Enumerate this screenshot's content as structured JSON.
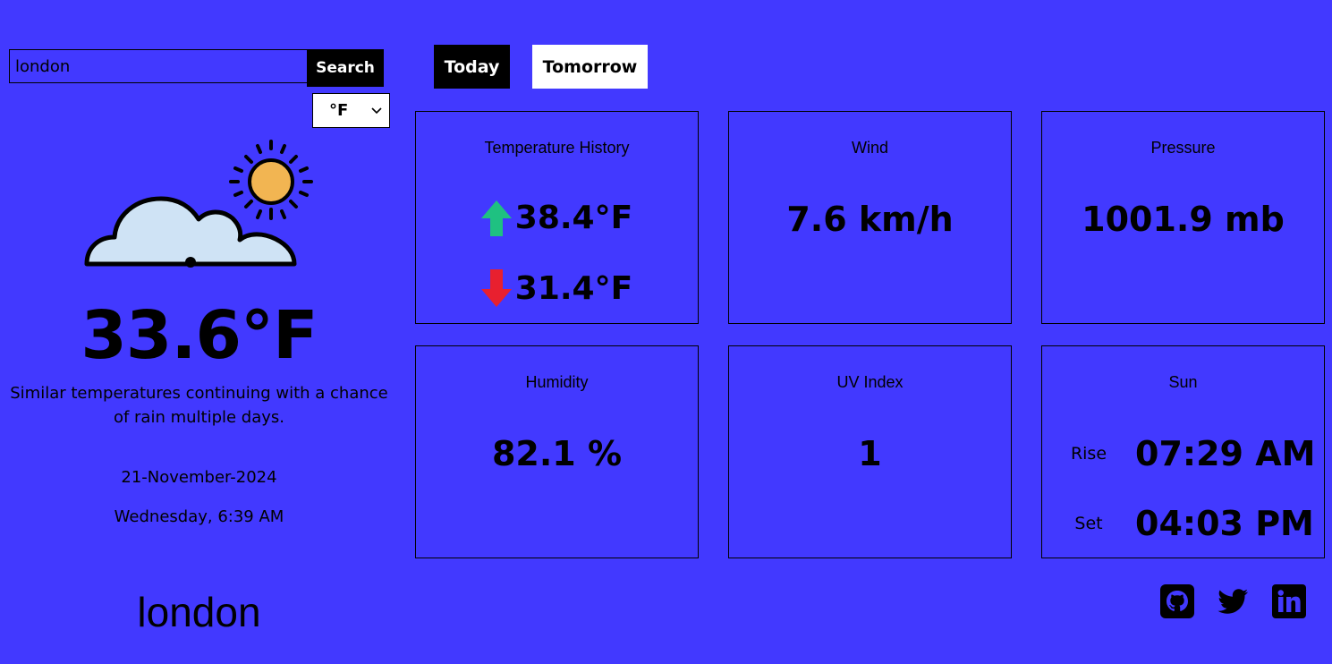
{
  "search": {
    "value": "london",
    "button_label": "Search"
  },
  "units": {
    "selected": "°F",
    "chevron_icon": "chevron-down-icon"
  },
  "current": {
    "icon": "cloud-sun-icon",
    "temperature": "33.6°F",
    "description": "Similar temperatures continuing with a chance of rain multiple days.",
    "date": "21-November-2024",
    "day_time": "Wednesday, 6:39 AM",
    "city": "london"
  },
  "tabs": [
    {
      "label": "Today",
      "active": true
    },
    {
      "label": "Tomorrow",
      "active": false
    }
  ],
  "cards": {
    "temperature_history": {
      "title": "Temperature History",
      "high": "38.4°F",
      "low": "31.4°F"
    },
    "wind": {
      "title": "Wind",
      "value": "7.6 km/h"
    },
    "pressure": {
      "title": "Pressure",
      "value": "1001.9 mb"
    },
    "humidity": {
      "title": "Humidity",
      "value": "82.1 %"
    },
    "uv_index": {
      "title": "UV Index",
      "value": "1"
    },
    "sun": {
      "title": "Sun",
      "rise_label": "Rise",
      "rise": "07:29 AM",
      "set_label": "Set",
      "set": "04:03 PM"
    }
  },
  "colors": {
    "background": "#4239ff",
    "up_arrow": "#1fc181",
    "down_arrow": "#e8202f",
    "sun": "#f2b552",
    "cloud": "#cfe3f5"
  },
  "social": [
    "github-icon",
    "twitter-icon",
    "linkedin-icon"
  ]
}
